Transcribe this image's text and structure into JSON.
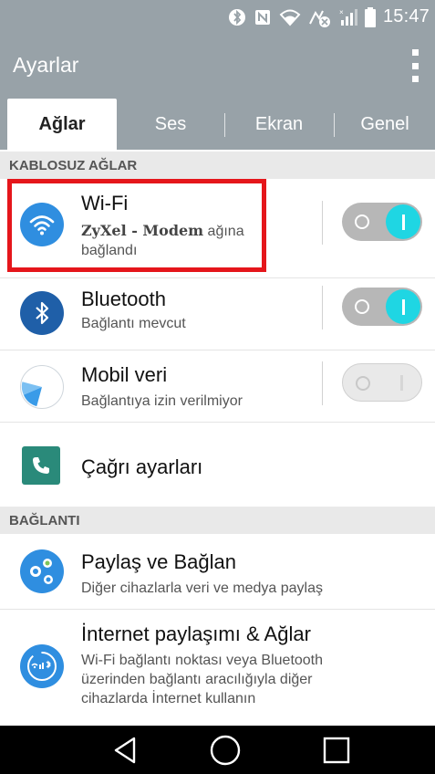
{
  "status_bar": {
    "time": "15:47",
    "icons": [
      "bluetooth-icon",
      "nfc-icon",
      "wifi-icon",
      "data-saver-icon",
      "signal-icon",
      "battery-icon"
    ]
  },
  "appbar": {
    "title": "Ayarlar",
    "menu_icon": "overflow-menu-icon"
  },
  "tabs": [
    {
      "label": "Ağlar",
      "active": true
    },
    {
      "label": "Ses",
      "active": false
    },
    {
      "label": "Ekran",
      "active": false
    },
    {
      "label": "Genel",
      "active": false
    }
  ],
  "sections": {
    "wireless": "KABLOSUZ AĞLAR",
    "connection": "BAĞLANTI"
  },
  "wireless_items": [
    {
      "title": "Wi-Fi",
      "subtitle_network": "ZyXel - Modem",
      "subtitle_rest": " ağına",
      "subtitle_line2": "bağlandı",
      "toggle": "on",
      "icon": "wifi-icon"
    },
    {
      "title": "Bluetooth",
      "subtitle": "Bağlantı mevcut",
      "toggle": "on",
      "icon": "bluetooth-icon"
    },
    {
      "title": "Mobil veri",
      "subtitle": "Bağlantıya izin verilmiyor",
      "toggle": "off",
      "icon": "mobile-data-icon"
    },
    {
      "title": "Çağrı ayarları",
      "icon": "phone-icon"
    }
  ],
  "connection_items": [
    {
      "title": "Paylaş ve Bağlan",
      "subtitle": "Diğer cihazlarla veri ve medya paylaş",
      "icon": "share-connect-icon"
    },
    {
      "title": "İnternet paylaşımı & Ağlar",
      "subtitle_lines": [
        "Wi-Fi bağlantı noktası veya Bluetooth",
        "üzerinden bağlantı aracılığıyla diğer",
        "cihazlarda İnternet kullanın"
      ],
      "icon": "tethering-icon"
    }
  ],
  "navbar": {
    "back_icon": "back-icon",
    "home_icon": "home-icon",
    "recents_icon": "recents-icon"
  },
  "colors": {
    "header": "#98a2a8",
    "toggle_on": "#1fd6e3",
    "highlight": "#e5161b",
    "icon_blue": "#2f8ee0",
    "icon_dark_blue": "#1f5fa8",
    "icon_teal": "#2a8a7a"
  }
}
